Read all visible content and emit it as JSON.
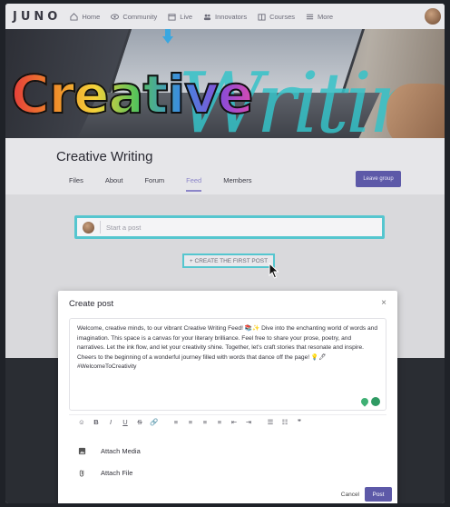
{
  "nav": {
    "logo": "JUNO",
    "items": [
      {
        "label": "Home",
        "icon": "home-icon"
      },
      {
        "label": "Community",
        "icon": "eye-icon"
      },
      {
        "label": "Live",
        "icon": "calendar-icon"
      },
      {
        "label": "Innovators",
        "icon": "people-icon"
      },
      {
        "label": "Courses",
        "icon": "book-icon"
      },
      {
        "label": "More",
        "icon": "menu-icon"
      }
    ]
  },
  "banner": {
    "headline": "Creative",
    "script_text": "Writing"
  },
  "group": {
    "title": "Creative Writing",
    "tabs": [
      "Files",
      "About",
      "Forum",
      "Feed",
      "Members"
    ],
    "active_tab": "Feed",
    "leave_label": "Leave group"
  },
  "start_post": {
    "placeholder": "Start a post"
  },
  "first_post_label": "+ CREATE THE FIRST POST",
  "modal": {
    "title": "Create post",
    "close_label": "×",
    "body": "Welcome, creative minds, to our vibrant Creative Writing Feed! 📚✨ Dive into the enchanting world of words and imagination. This space is a canvas for your literary brilliance. Feel free to share your prose, poetry, and narratives. Let the ink flow, and let your creativity shine. Together, let's craft stories that resonate and inspire. Cheers to the beginning of a wonderful journey filled with words that dance off the page! 💡🖊 #WelcomeToCreativity",
    "toolbar": [
      "☺",
      "B",
      "I",
      "U",
      "S",
      "🔗",
      "≡",
      "≡",
      "≡",
      "≡",
      "⇤",
      "⇥",
      "☰",
      "☷",
      "❞"
    ],
    "attach_media": "Attach Media",
    "attach_file": "Attach File",
    "cancel_label": "Cancel",
    "post_label": "Post"
  },
  "colors": {
    "accent": "#5d59a8",
    "highlight": "#55c6cf"
  }
}
